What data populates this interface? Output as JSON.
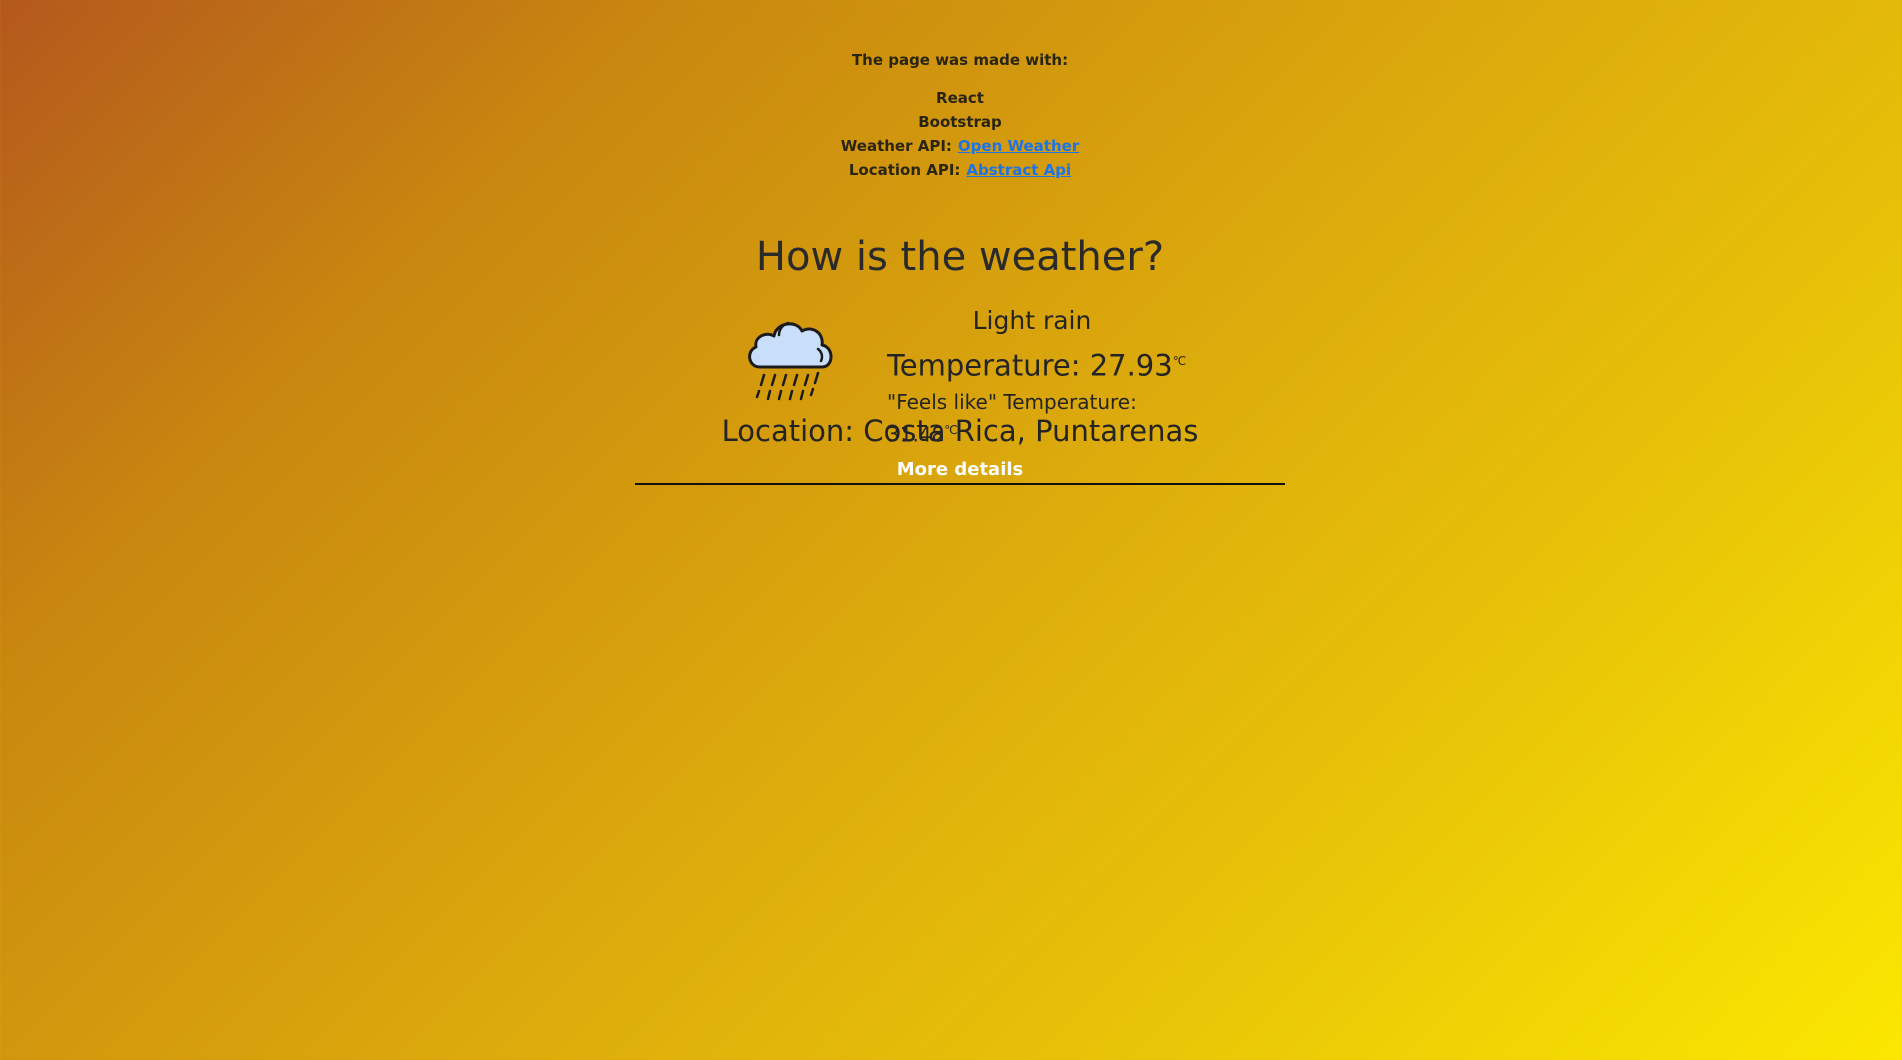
{
  "credits": {
    "heading": "The page was made with:",
    "items": [
      {
        "text": "React"
      },
      {
        "text": "Bootstrap"
      },
      {
        "label": "Weather API:",
        "link": "Open Weather"
      },
      {
        "label": "Location API:",
        "link": "Abstract Api"
      }
    ]
  },
  "main": {
    "title": "How is the weather?",
    "weather": {
      "icon": "rain-cloud-icon",
      "condition": "Light rain",
      "temperature_label": "Temperature: 27.93",
      "feels_like_label": "\"Feels like\" Temperature: 31.48",
      "unit": "℃"
    },
    "location": "Location: Costa Rica, Puntarenas",
    "details_button": "More details"
  },
  "colors": {
    "link": "#1e73e6",
    "button_text": "#ffffff",
    "gradient_start": "#b4581d",
    "gradient_end": "#fbe700",
    "cloud_fill": "#c9defa"
  }
}
